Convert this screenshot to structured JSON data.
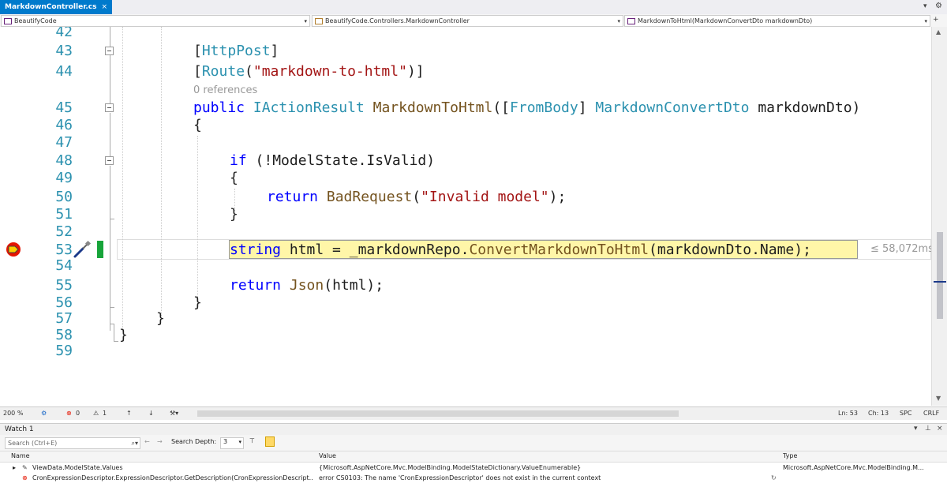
{
  "tab": {
    "label": "MarkdownController.cs",
    "close": "×"
  },
  "dropdowns": {
    "project": "BeautifyCode",
    "class": "BeautifyCode.Controllers.MarkdownController",
    "member": "MarkdownToHtml(MarkdownConvertDto markdownDto)"
  },
  "editor": {
    "line_numbers": [
      "42",
      "43",
      "44",
      "45",
      "46",
      "47",
      "48",
      "49",
      "50",
      "51",
      "52",
      "53",
      "54",
      "55",
      "56",
      "57",
      "58",
      "59"
    ],
    "references_label": "0 references",
    "lines": {
      "l43_open": "[",
      "l43_attr": "HttpPost",
      "l43_close": "]",
      "l44_open": "[",
      "l44_attr": "Route",
      "l44_paren": "(",
      "l44_str": "\"markdown-to-html\"",
      "l44_close": ")]",
      "l45_kw": "public",
      "l45_type": "IActionResult",
      "l45_fn": "MarkdownToHtml",
      "l45_p1": "([",
      "l45_attr": "FromBody",
      "l45_p2": "] ",
      "l45_ptype": "MarkdownConvertDto",
      "l45_pname": " markdownDto)",
      "l46": "{",
      "l48_kw": "if",
      "l48_rest": " (!ModelState.IsValid)",
      "l49": "{",
      "l50_kw": "return",
      "l50_fn": "BadRequest",
      "l50_p1": "(",
      "l50_str": "\"Invalid model\"",
      "l50_p2": ");",
      "l51": "}",
      "l53_kw": "string",
      "l53_a": " html = _markdownRepo.",
      "l53_fn": "ConvertMarkdownToHtml",
      "l53_b": "(markdownDto.Name);",
      "l55_kw": "return",
      "l55_fn": "Json",
      "l55_rest": "(html);",
      "l56": "}",
      "l57": "}",
      "l58": "}"
    },
    "perf_tip": "≤ 58,072ms"
  },
  "editor_status": {
    "zoom": "200 %",
    "errors": "0",
    "warnings": "1",
    "line": "Ln: 53",
    "col": "Ch: 13",
    "spc": "SPC",
    "crlf": "CRLF"
  },
  "watch": {
    "title": "Watch 1",
    "search_placeholder": "Search (Ctrl+E)",
    "search_depth_label": "Search Depth:",
    "search_depth_value": "3",
    "columns": [
      "Name",
      "Value",
      "Type"
    ],
    "rows": [
      {
        "name": "ViewData.ModelState.Values",
        "value": "{Microsoft.AspNetCore.Mvc.ModelBinding.ModelStateDictionary.ValueEnumerable}",
        "type": "Microsoft.AspNetCore.Mvc.ModelBinding.M..."
      },
      {
        "name": "CronExpressionDescriptor.ExpressionDescriptor.GetDescription(CronExpressionDescript...",
        "value": "error CS0103: The name 'CronExpressionDescriptor' does not exist in the current context",
        "type": ""
      }
    ]
  },
  "colors": {
    "accent": "#007acc",
    "keyword": "#0000ff",
    "type": "#2b91af",
    "string": "#a31515",
    "highlight": "#fff6a8",
    "breakpoint": "#e51400"
  }
}
